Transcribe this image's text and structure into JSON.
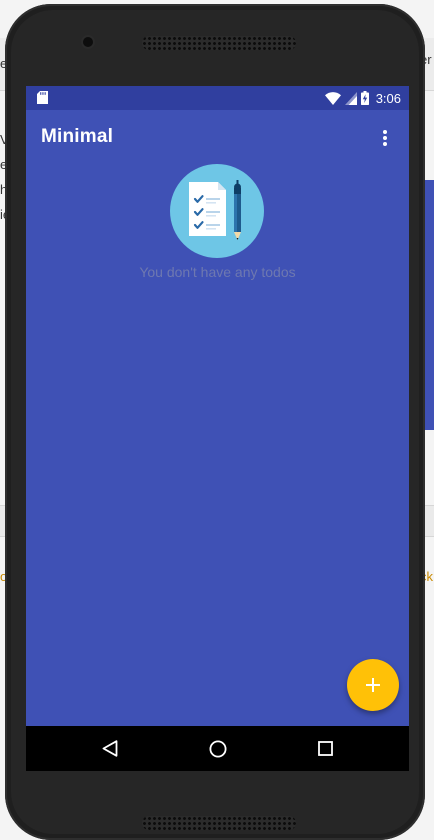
{
  "background": {
    "fragments": [
      "ev",
      "er",
      "Vi",
      "er",
      "he",
      "ie",
      "ot",
      "ck"
    ]
  },
  "status_bar": {
    "time": "3:06",
    "icons": [
      "sd-card-icon",
      "wifi-icon",
      "cell-signal-icon",
      "battery-charging-icon"
    ]
  },
  "app_bar": {
    "title": "Minimal",
    "overflow_icon": "more-vert-icon"
  },
  "empty_state": {
    "illustration": "todo-checklist-illustration",
    "message": "You don't have any todos"
  },
  "fab": {
    "icon": "plus-icon"
  },
  "nav_bar": {
    "buttons": [
      "back-icon",
      "home-icon",
      "recents-icon"
    ]
  },
  "colors": {
    "primary": "#3f51b5",
    "primary_dark": "#303f9f",
    "accent": "#ffc107",
    "empty_text": "#6e78b0"
  }
}
